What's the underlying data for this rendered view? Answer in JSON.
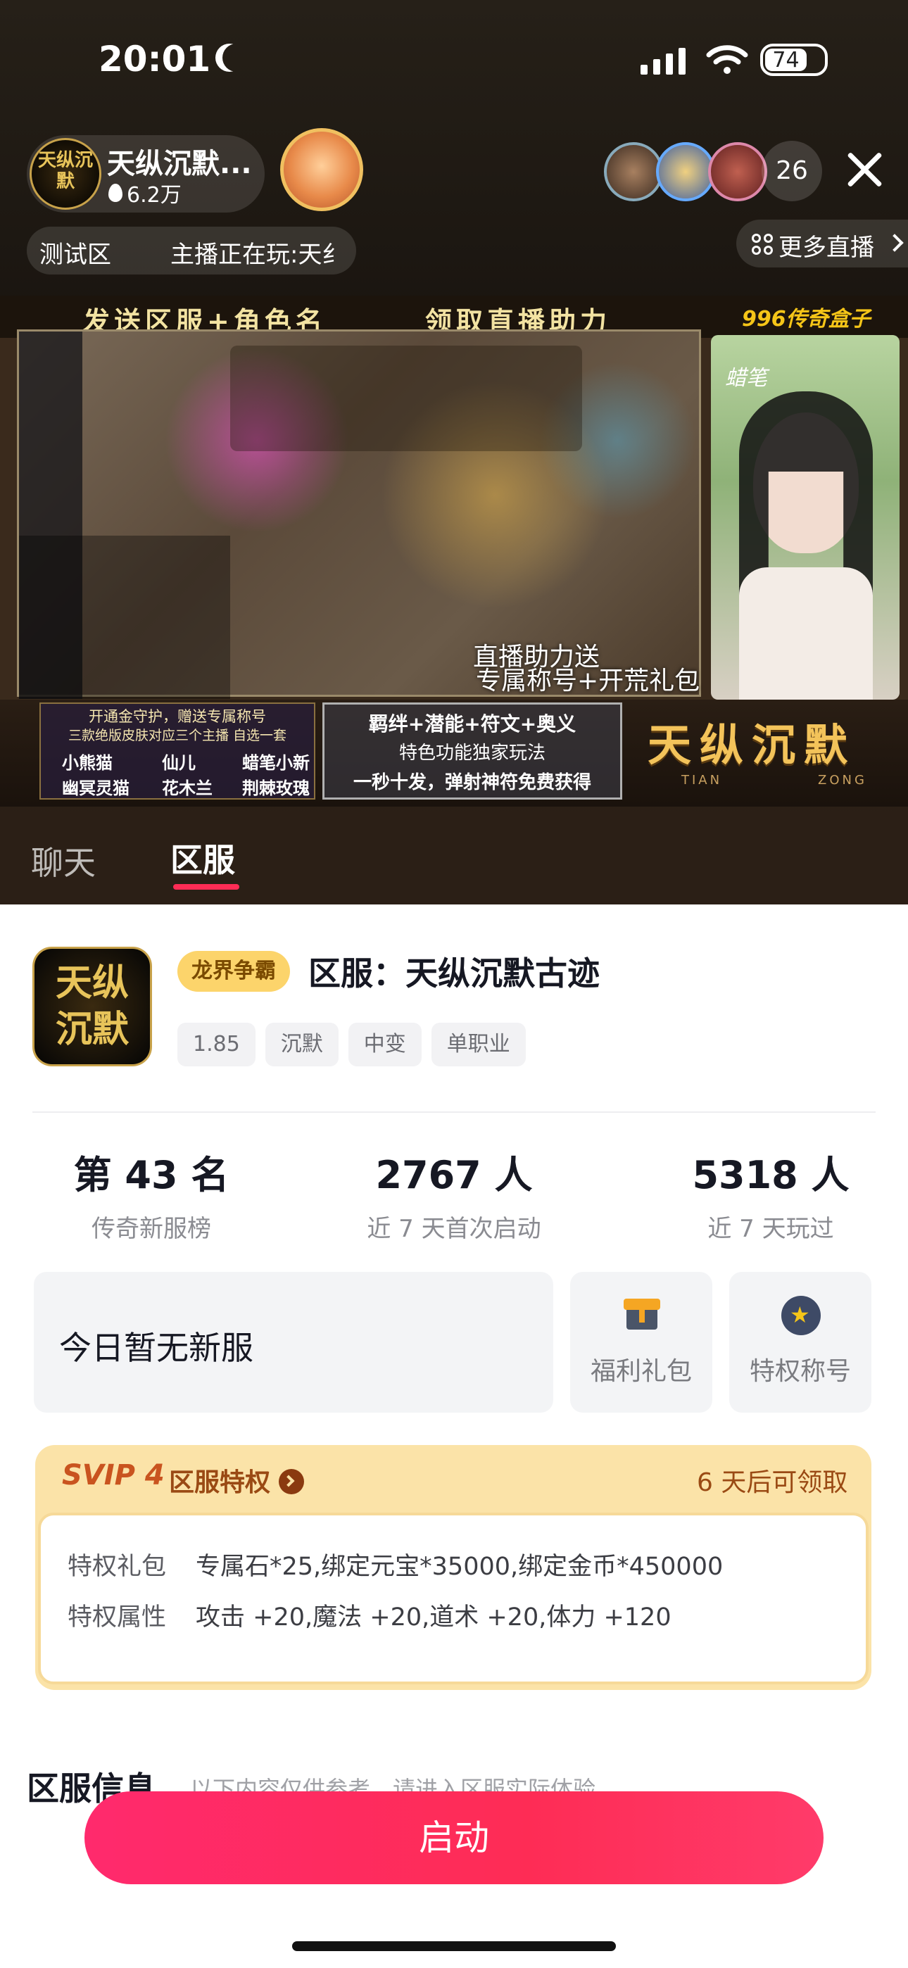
{
  "status_bar": {
    "time": "20:01",
    "battery": "74"
  },
  "streamer": {
    "name": "天纵沉默...",
    "popularity": "6.2万",
    "avatar_text": "天纵沉默"
  },
  "viewers": {
    "count": "26"
  },
  "ticker": {
    "section_label": "测试区",
    "playing_text": "主播正在玩:天纟",
    "more_live": "更多直播"
  },
  "video": {
    "top_banner_left": "发送区服+角色名",
    "top_banner_right": "领取直播助力",
    "box_brand": "996传奇盒子",
    "assist_line1": "直播助力送",
    "assist_line2": "专属称号+开荒礼包",
    "promo_left_title": "开通金守护，赠送专属称号",
    "promo_left_sub": "三款绝版皮肤对应三个主播 自选一套",
    "skins": [
      "小熊猫",
      "仙儿",
      "蜡笔小新",
      "幽冥灵猫",
      "花木兰",
      "荆棘玫瑰"
    ],
    "promo_mid_1": "羁绊+潜能+符文+奥义",
    "promo_mid_2": "特色功能独家玩法",
    "promo_mid_3": "一秒十发，弹射神符免费获得",
    "logo_main": "天纵沉默",
    "logo_sub_left": "TIAN",
    "logo_sub_right": "ZONG",
    "streamer_sign": "蜡笔"
  },
  "tabs": [
    {
      "label": "聊天"
    },
    {
      "label": "区服"
    }
  ],
  "server": {
    "app_icon_text": "天纵沉默",
    "badge": "龙界争霸",
    "title": "区服：天纵沉默古迹",
    "tags": [
      "1.85",
      "沉默",
      "中变",
      "单职业"
    ]
  },
  "stats": [
    {
      "value": "第 43 名",
      "label": "传奇新服榜"
    },
    {
      "value": "2767 人",
      "label": "近 7 天首次启动"
    },
    {
      "value": "5318 人",
      "label": "近 7 天玩过"
    }
  ],
  "new_server": {
    "text": "今日暂无新服"
  },
  "quick_actions": [
    {
      "label": "福利礼包"
    },
    {
      "label": "特权称号"
    }
  ],
  "svip": {
    "brand": "SVIP 4",
    "title": "区服特权",
    "status": "6 天后可领取",
    "rows": [
      {
        "label": "特权礼包",
        "value": "专属石*25,绑定元宝*35000,绑定金币*450000"
      },
      {
        "label": "特权属性",
        "value": "攻击 +20,魔法 +20,道术 +20,体力 +120"
      }
    ]
  },
  "info": {
    "title": "区服信息",
    "note": "以下内容仅供参考，请进入区服实际体验"
  },
  "start_button": {
    "label": "启动"
  },
  "colors": {
    "accent": "#fe2c55",
    "badge_bg": "#fcd46b",
    "svip_bg": "#fbe3a8"
  }
}
